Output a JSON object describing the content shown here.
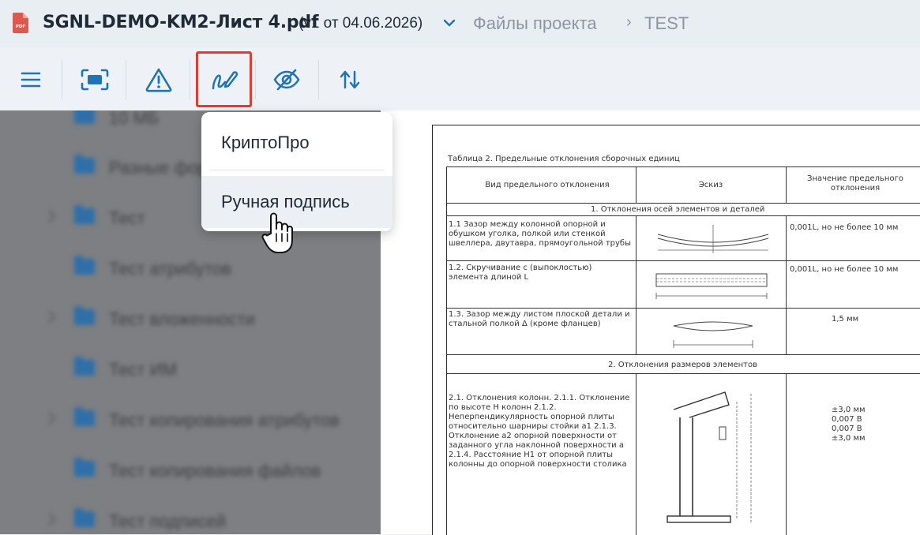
{
  "header": {
    "file_name": "SGNL-DEMO-KM2-Лист 4.pdf",
    "version": "(v1 от 04.06.2026)",
    "breadcrumb": [
      "Файлы проекта",
      "TEST"
    ],
    "breadcrumb_separator": "›",
    "pdf_badge": "PDF"
  },
  "toolbar": {
    "items": [
      {
        "icon": "menu-icon"
      },
      {
        "icon": "fit-screen-icon"
      },
      {
        "icon": "warning-icon"
      },
      {
        "icon": "signature-icon",
        "active": true
      },
      {
        "icon": "eye-off-icon"
      },
      {
        "icon": "sort-arrows-icon"
      }
    ]
  },
  "sign_menu": {
    "items": [
      {
        "label": "КриптоПро"
      },
      {
        "label": "Ручная подпись",
        "hovered": true
      }
    ]
  },
  "file_tree": {
    "items": [
      {
        "label": "10 МБ",
        "expandable": false
      },
      {
        "label": "Разные форматы",
        "expandable": false
      },
      {
        "label": "Тест",
        "expandable": true
      },
      {
        "label": "Тест атрибутов",
        "expandable": false
      },
      {
        "label": "Тест вложенности",
        "expandable": true
      },
      {
        "label": "Тест ИМ",
        "expandable": false
      },
      {
        "label": "Тест копирования атрибутов",
        "expandable": true
      },
      {
        "label": "Тест копирования файлов",
        "expandable": false
      },
      {
        "label": "Тест подписей",
        "expandable": true
      }
    ]
  },
  "document": {
    "table_caption": "Таблица 2. Предельные отклонения сборочных единиц",
    "col_headers": [
      "Вид предельного отклонения",
      "Эскиз",
      "Значение предельного отклонения"
    ],
    "section1": "1. Отклонения осей элементов и деталей",
    "rows1": [
      {
        "desc": "1.1 Зазор между колонной опорной и обушком уголка, полкой или стенкой швеллера, двутавра, прямоугольной трубы",
        "value": "0,001L, но не более 10 мм"
      },
      {
        "desc": "1.2. Скручивание с (выпоклостью) элемента длиной L",
        "value": "0,001L, но не более 10 мм"
      },
      {
        "desc": "1.3. Зазор между листом плоской детали и стальной полкой Δ (кроме фланцев)",
        "value": "1,5 мм"
      }
    ],
    "section2": "2. Отклонения размеров элементов",
    "rows2_desc": "2.1. Отклонения колонн. 2.1.1. Отклонение по высоте Н колонн 2.1.2. Неперпендикулярность опорной плиты относительно шарниры стойки а1 2.1.3. Отклонение а2 опорной поверхности от заданного угла наклонной поверхности а 2.1.4. Расстояние Н1 от опорной плиты колонны до опорной поверхности столика",
    "rows2_values": [
      "±3,0 мм",
      "0,007 В",
      "0,007 В",
      "±3,0 мм"
    ]
  },
  "colors": {
    "accent": "#1f73b7",
    "active_border": "#e53935",
    "title_text": "#1f2a37",
    "muted_text": "#8c96a3"
  }
}
